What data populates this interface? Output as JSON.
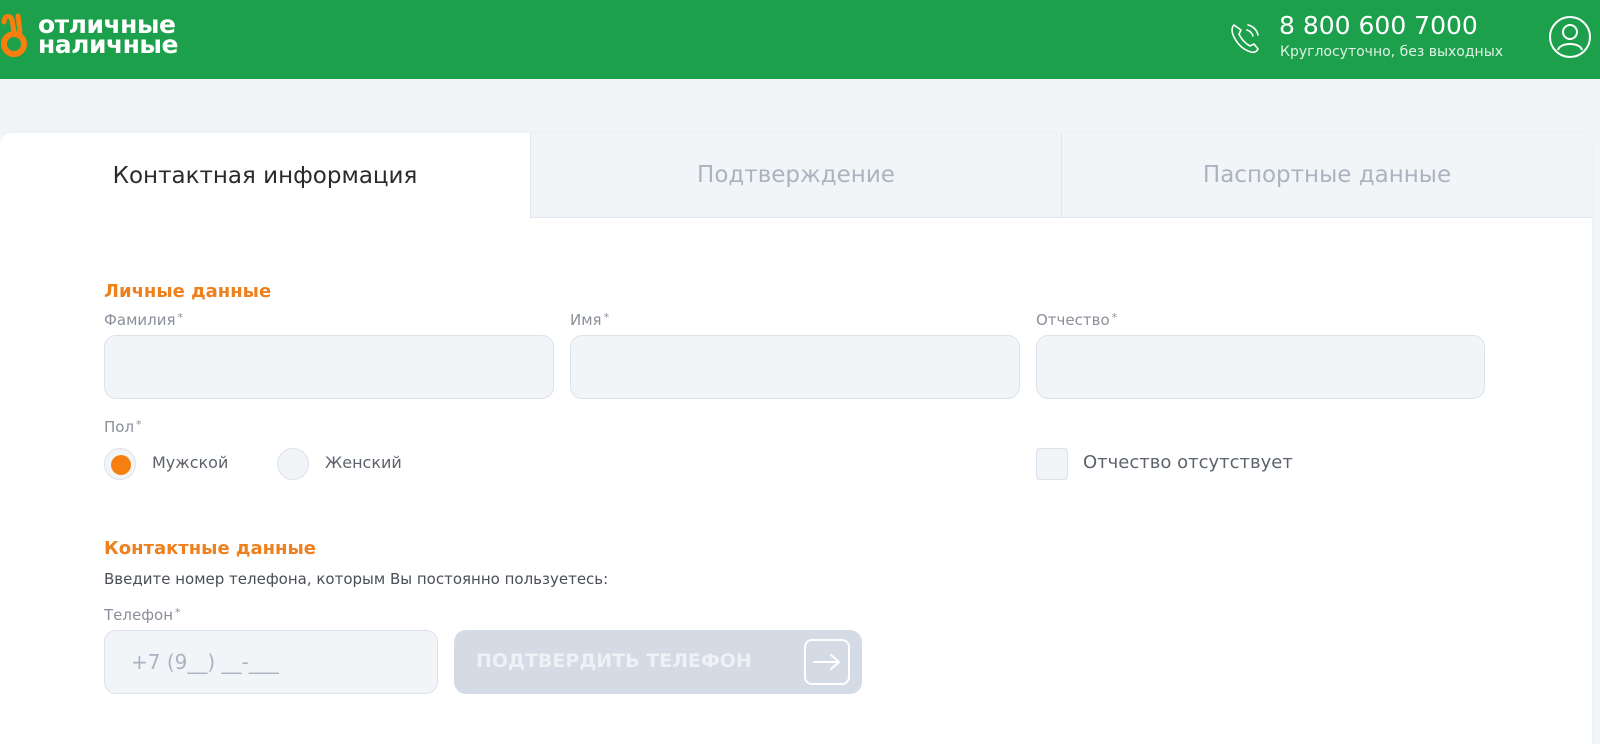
{
  "header": {
    "logo_line1": "отличные",
    "logo_line2": "наличные",
    "phone": "8 800 600 7000",
    "phone_sub": "Круглосуточно, без выходных",
    "brand_color": "#1ca04b",
    "accent_color": "#f77f0f"
  },
  "tabs": [
    {
      "label": "Контактная информация",
      "active": true
    },
    {
      "label": "Подтверждение",
      "active": false
    },
    {
      "label": "Паспортные данные",
      "active": false
    }
  ],
  "personal": {
    "title": "Личные данные",
    "surname_label": "Фамилия",
    "name_label": "Имя",
    "patronymic_label": "Отчество",
    "required_mark": "*",
    "gender_label": "Пол",
    "gender_male": "Мужской",
    "gender_female": "Женский",
    "no_patronymic": "Отчество отсутствует"
  },
  "contact": {
    "title": "Контактные данные",
    "hint": "Введите номер телефона, которым Вы постоянно пользуетесь:",
    "phone_label": "Телефон",
    "phone_placeholder": "+7 (9__) __-___",
    "confirm_button": "ПОДТВЕРДИТЬ ТЕЛЕФОН"
  }
}
